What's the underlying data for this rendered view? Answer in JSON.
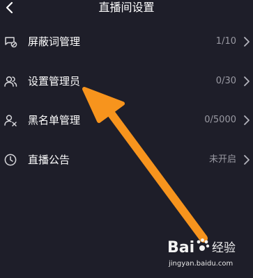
{
  "header": {
    "title": "直播间设置",
    "back_icon": "chevron-left-icon"
  },
  "settings": [
    {
      "label": "屏蔽词管理",
      "value": "1/10",
      "icon": "comment-blocked-icon"
    },
    {
      "label": "设置管理员",
      "value": "0/30",
      "icon": "users-icon"
    },
    {
      "label": "黑名单管理",
      "value": "0/5000",
      "icon": "user-blocked-icon"
    },
    {
      "label": "直播公告",
      "value": "未开启",
      "icon": "clock-icon"
    }
  ],
  "overlay": {
    "arrow_color": "#f7941d",
    "arrow_icon": "pointer-arrow-icon"
  },
  "watermark": {
    "logo_text": "Bai经验",
    "url": "jingyan.baidu.com"
  },
  "colors": {
    "background": "#1e1e29",
    "text_primary": "#ffffff",
    "text_secondary": "#9a9aa3"
  }
}
